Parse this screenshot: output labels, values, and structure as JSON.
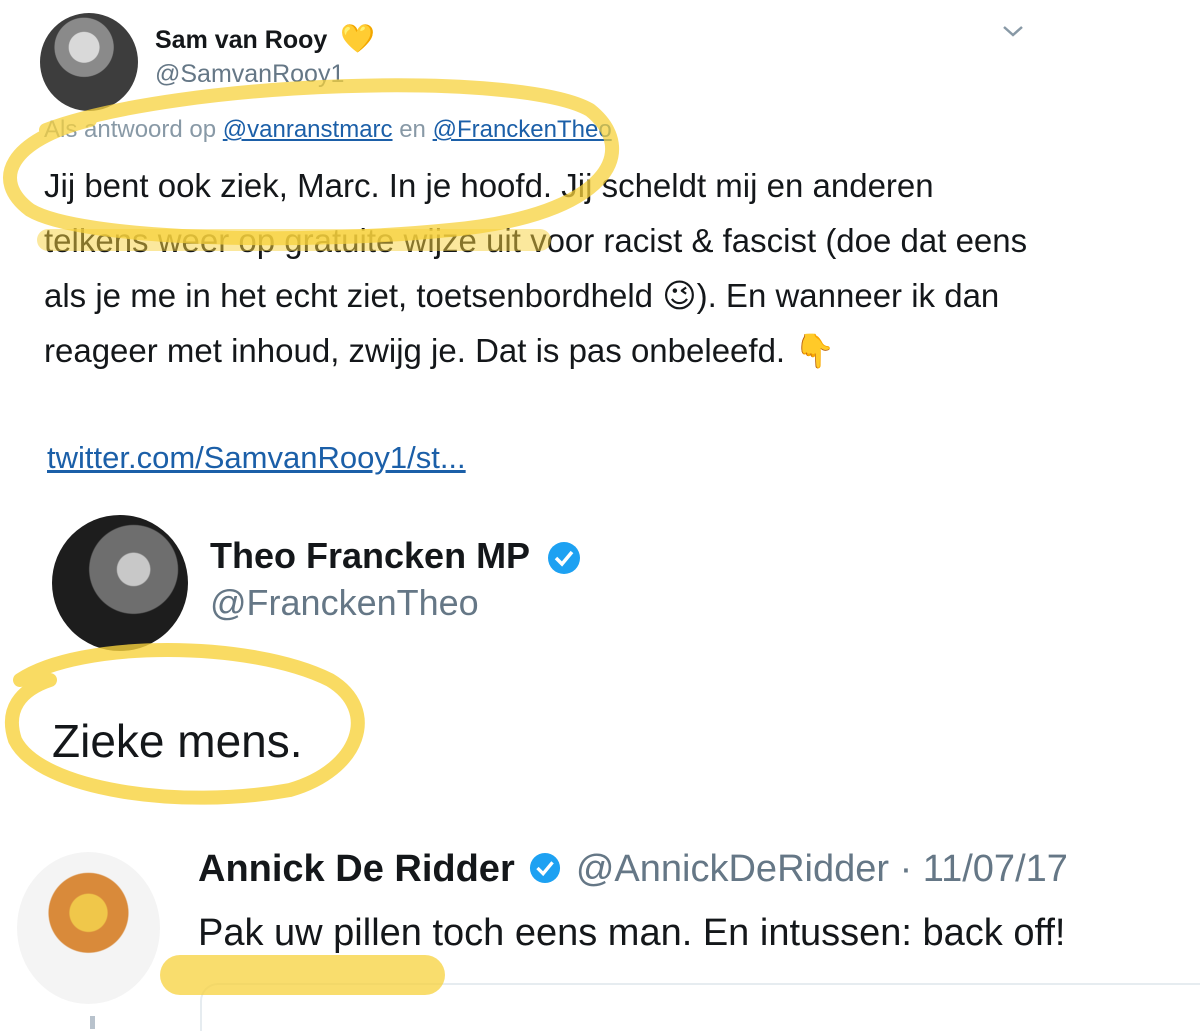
{
  "tweet1": {
    "name": "Sam van Rooy",
    "name_emoji": "💛",
    "handle": "@SamvanRooy1",
    "reply_prefix": "Als antwoord op",
    "reply_mention1": "@vanranstmarc",
    "reply_and": "en",
    "reply_mention2": "@FranckenTheo",
    "text": "Jij bent ook ziek, Marc. In je hoofd. Jij scheldt mij en anderen telkens weer op gratuite wijze uit voor racist & fascist (doe dat eens als je me in het echt ziet, toetsenbordheld 😉). En wanneer ik dan reageer met inhoud, zwijg je. Dat is pas onbeleefd. 👇",
    "link": "twitter.com/SamvanRooy1/st..."
  },
  "tweet2": {
    "name": "Theo Francken MP",
    "handle": "@FranckenTheo",
    "text": "Zieke mens."
  },
  "tweet3": {
    "name": "Annick De Ridder",
    "handle": "@AnnickDeRidder",
    "date": "· 11/07/17",
    "text": "Pak uw pillen toch eens man. En intussen: back off!"
  },
  "icons": {
    "chevron": "chevron-down-icon",
    "verified": "verified-badge-icon"
  },
  "colors": {
    "highlight": "#f7d23c",
    "link": "#1b5fa8",
    "verified": "#1da1f2",
    "secondary": "#657786"
  }
}
